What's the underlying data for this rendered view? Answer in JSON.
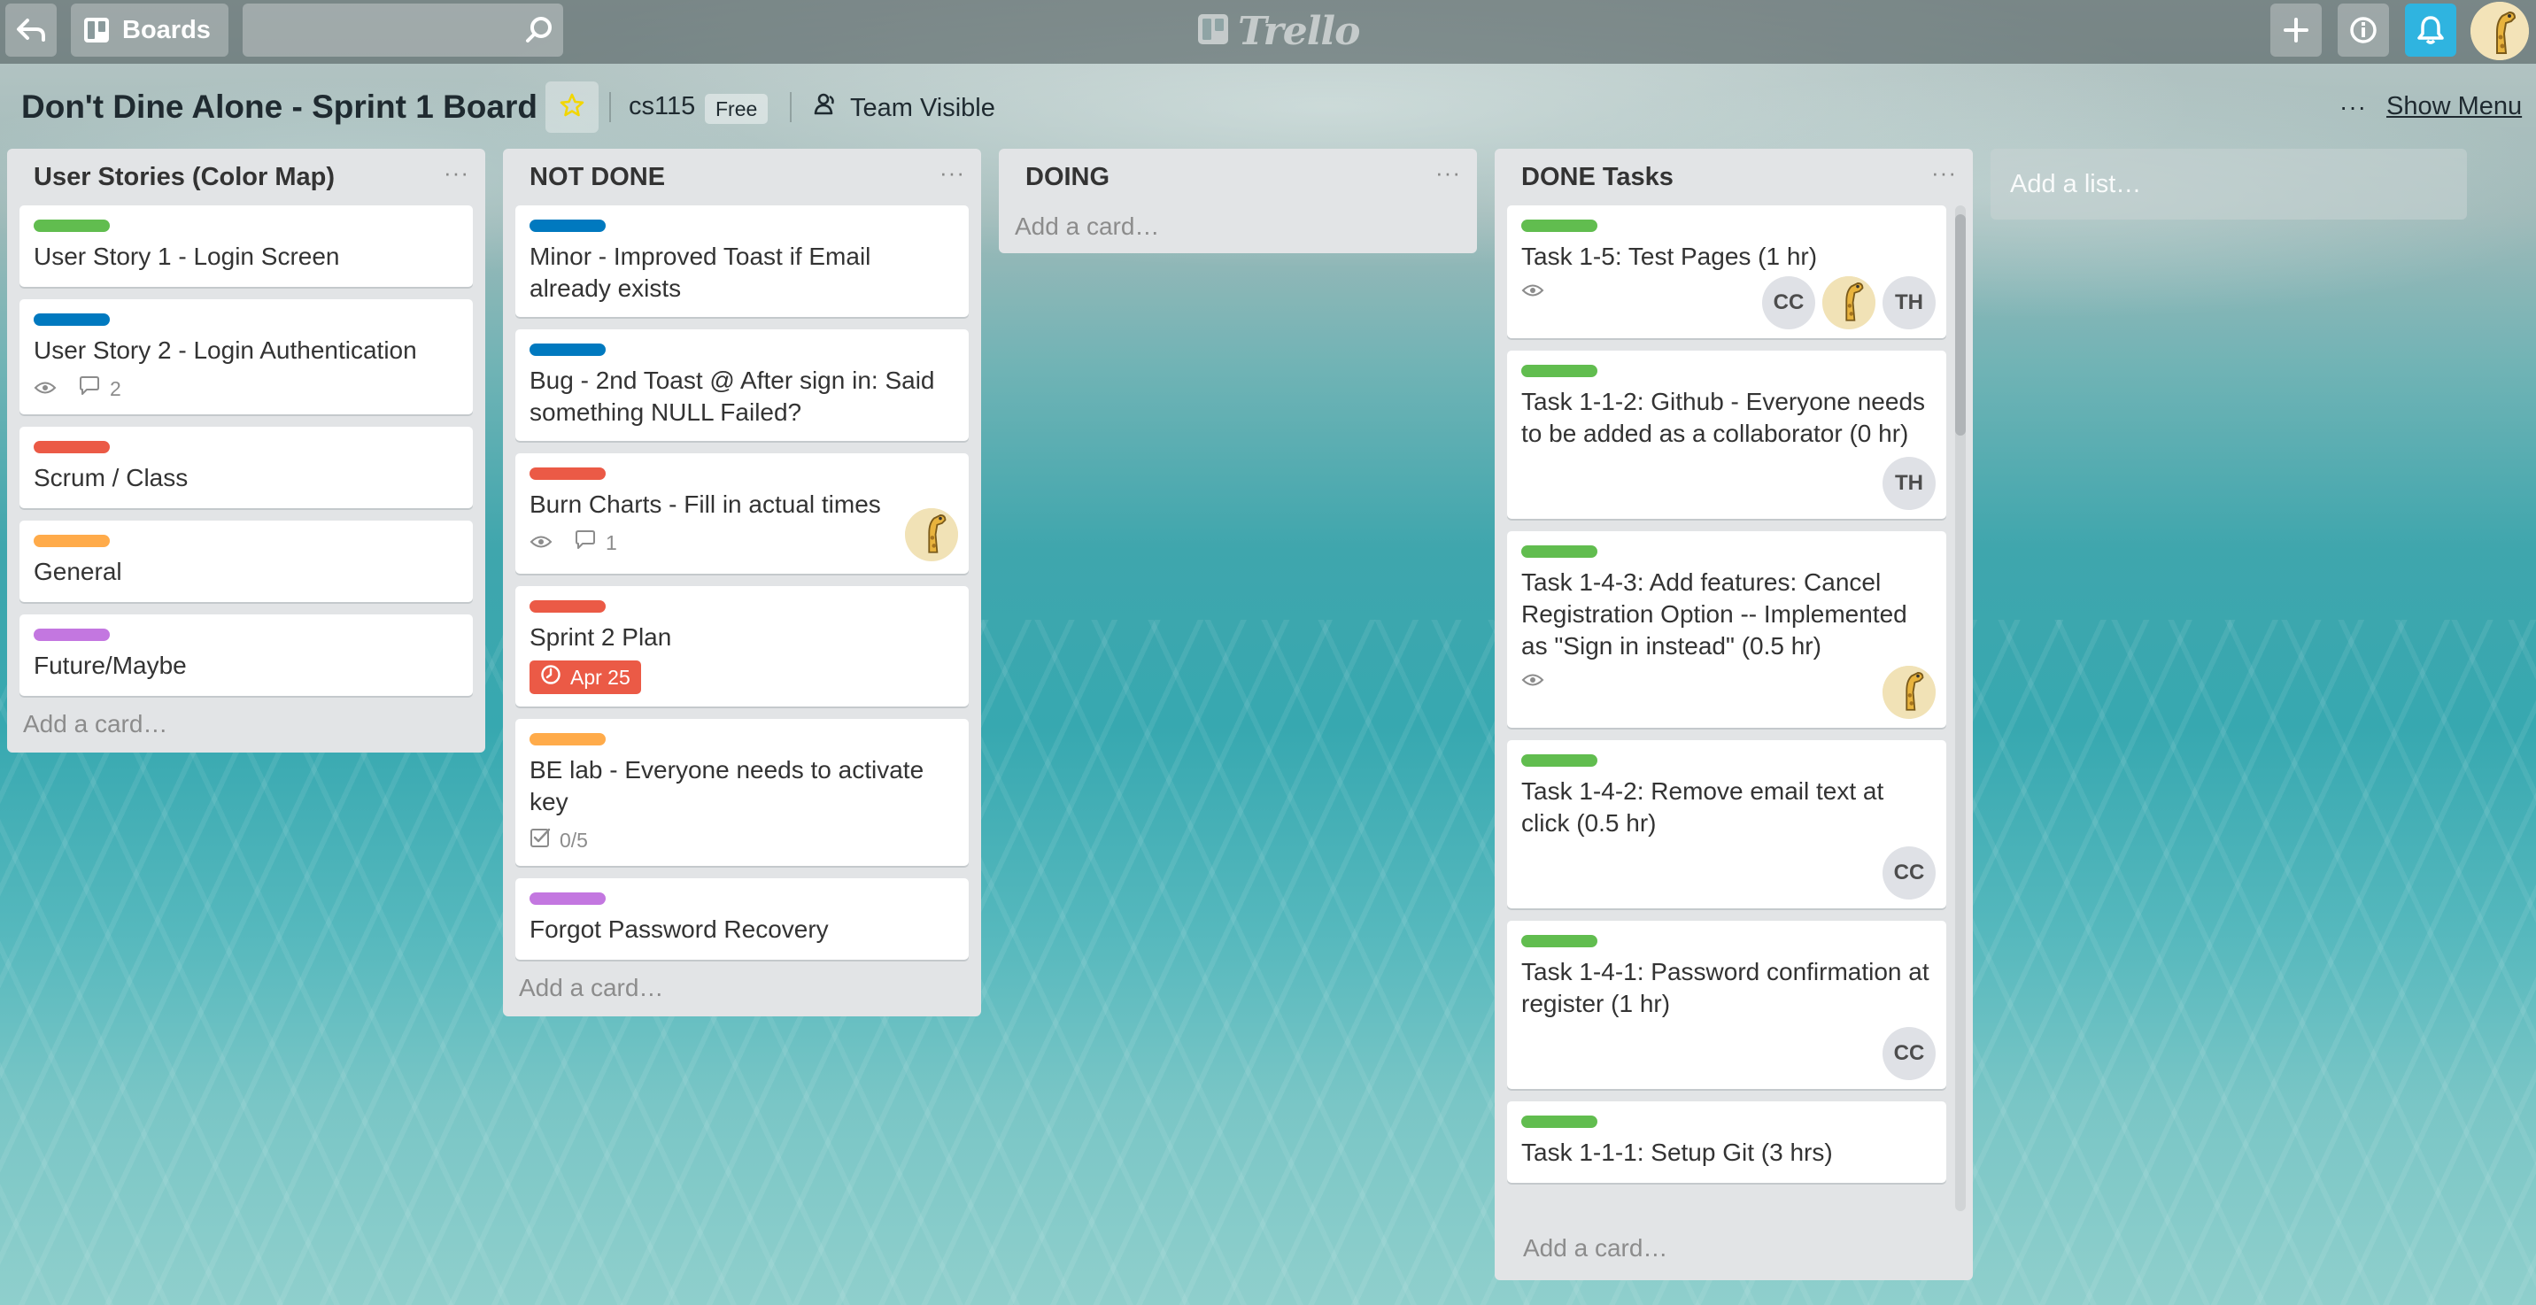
{
  "header": {
    "back_icon": "back-arrow-icon",
    "boards_label": "Boards",
    "search_placeholder": "",
    "logo_text": "Trello",
    "add_icon": "plus-icon",
    "info_icon": "info-icon",
    "notification_icon": "bell-icon",
    "notification_color": "#2fb4e0"
  },
  "board": {
    "title": "Don't Dine Alone - Sprint 1 Board",
    "starred": true,
    "team": "cs115",
    "plan": "Free",
    "visibility": "Team Visible",
    "show_menu": "Show Menu",
    "menu_dots": "···"
  },
  "list_menu_dots": "···",
  "lists": [
    {
      "title": "User Stories (Color Map)",
      "add_card": "Add a card…",
      "cards": [
        {
          "label_color": "#61bd4f",
          "title": "User Story 1 - Login Screen"
        },
        {
          "label_color": "#0079bf",
          "title": "User Story 2 - Login Authentication",
          "watch": true,
          "comments": "2"
        },
        {
          "label_color": "#eb5a46",
          "title": "Scrum / Class"
        },
        {
          "label_color": "#ffab4a",
          "title": "General"
        },
        {
          "label_color": "#c377e0",
          "title": "Future/Maybe"
        }
      ]
    },
    {
      "title": "NOT DONE",
      "add_card": "Add a card…",
      "cards": [
        {
          "label_color": "#0079bf",
          "title": "Minor - Improved Toast if Email already exists"
        },
        {
          "label_color": "#0079bf",
          "title": "Bug - 2nd Toast @ After sign in: Said something NULL Failed?"
        },
        {
          "label_color": "#eb5a46",
          "title": "Burn Charts - Fill in actual times",
          "watch": true,
          "comments": "1",
          "members": [
            "giraffe"
          ]
        },
        {
          "label_color": "#eb5a46",
          "title": "Sprint 2 Plan",
          "due": "Apr 25",
          "due_color": "#eb5a46"
        },
        {
          "label_color": "#ffab4a",
          "title": "BE lab - Everyone needs to activate key",
          "checklist": "0/5"
        },
        {
          "label_color": "#c377e0",
          "title": "Forgot Password Recovery"
        }
      ]
    },
    {
      "title": "DOING",
      "add_card": "Add a card…",
      "cards": []
    },
    {
      "title": "DONE Tasks",
      "add_card": "Add a card…",
      "cards": [
        {
          "label_color": "#61bd4f",
          "title": "Task 1-5: Test Pages (1 hr)",
          "watch": true,
          "members": [
            "CC",
            "giraffe",
            "TH"
          ]
        },
        {
          "label_color": "#61bd4f",
          "title": "Task 1-1-2: Github - Everyone needs to be added as a collaborator (0 hr)",
          "members": [
            "TH"
          ]
        },
        {
          "label_color": "#61bd4f",
          "title": "Task 1-4-3: Add features: Cancel Registration Option -- Implemented as \"Sign in instead\" (0.5 hr)",
          "watch": true,
          "members": [
            "giraffe"
          ]
        },
        {
          "label_color": "#61bd4f",
          "title": "Task 1-4-2: Remove email text at click (0.5 hr)",
          "members": [
            "CC"
          ]
        },
        {
          "label_color": "#61bd4f",
          "title": "Task 1-4-1: Password confirmation at register (1 hr)",
          "members": [
            "CC"
          ]
        },
        {
          "label_color": "#61bd4f",
          "title": "Task 1-1-1: Setup Git (3 hrs)"
        }
      ]
    }
  ],
  "add_list": "Add a list…"
}
